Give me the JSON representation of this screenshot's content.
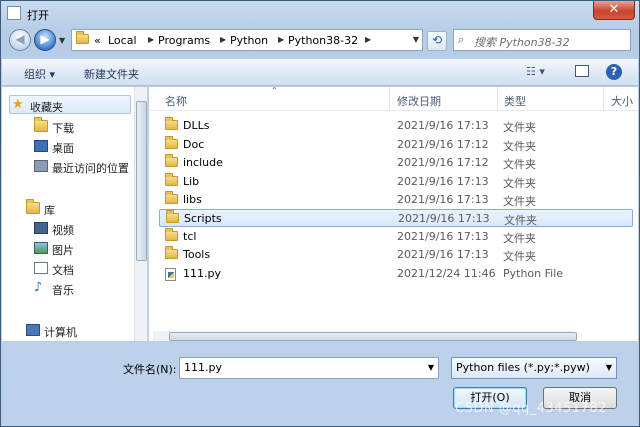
{
  "window": {
    "title": "打开",
    "close_glyph": "✕"
  },
  "address": {
    "prefix": "«",
    "crumbs": [
      "Local",
      "Programs",
      "Python",
      "Python38-32"
    ],
    "search_placeholder": "搜索 Python38-32"
  },
  "toolbar": {
    "organize": "组织 ▾",
    "new_folder": "新建文件夹",
    "views": "☷ ▾",
    "help": "?"
  },
  "nav": {
    "items": [
      {
        "label": "收藏夹",
        "icon": "star-icon"
      },
      {
        "label": "下载",
        "icon": "download-folder-icon"
      },
      {
        "label": "桌面",
        "icon": "desktop-icon"
      },
      {
        "label": "最近访问的位置",
        "icon": "recent-places-icon"
      },
      {
        "label": "库",
        "icon": "library-icon"
      },
      {
        "label": "视频",
        "icon": "video-icon"
      },
      {
        "label": "图片",
        "icon": "pictures-icon"
      },
      {
        "label": "文档",
        "icon": "documents-icon"
      },
      {
        "label": "音乐",
        "icon": "music-icon"
      },
      {
        "label": "计算机",
        "icon": "computer-icon"
      }
    ]
  },
  "columns": {
    "name": "名称",
    "date": "修改日期",
    "type": "类型",
    "size": "大小"
  },
  "files": [
    {
      "name": "DLLs",
      "date": "2021/9/16 17:13",
      "type": "文件夹"
    },
    {
      "name": "Doc",
      "date": "2021/9/16 17:12",
      "type": "文件夹"
    },
    {
      "name": "include",
      "date": "2021/9/16 17:12",
      "type": "文件夹"
    },
    {
      "name": "Lib",
      "date": "2021/9/16 17:13",
      "type": "文件夹"
    },
    {
      "name": "libs",
      "date": "2021/9/16 17:13",
      "type": "文件夹"
    },
    {
      "name": "Scripts",
      "date": "2021/9/16 17:13",
      "type": "文件夹"
    },
    {
      "name": "tcl",
      "date": "2021/9/16 17:13",
      "type": "文件夹"
    },
    {
      "name": "Tools",
      "date": "2021/9/16 17:13",
      "type": "文件夹"
    },
    {
      "name": "111.py",
      "date": "2021/12/24 11:46",
      "type": "Python File"
    }
  ],
  "bottom": {
    "filename_label": "文件名(N):",
    "filename_value": "111.py",
    "filter": "Python files (*.py;*.pyw)",
    "open": "打开(O)",
    "cancel": "取消"
  },
  "watermark": "CSDN @qq_43451782"
}
